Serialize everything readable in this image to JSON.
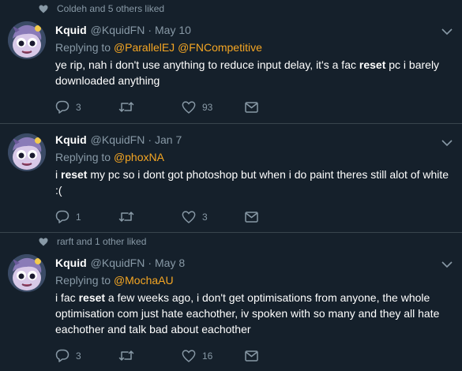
{
  "tweets": [
    {
      "liked_by": "Coldeh and 5 others liked",
      "name": "Kquid",
      "handle": "@KquidFN",
      "date": "May 10",
      "replying_to": "Replying to",
      "mentions": [
        "@ParallelEJ",
        "@FNCompetitive"
      ],
      "text_before": "ye rip, nah i don't use anything to reduce input delay, it's a fac ",
      "text_bold": "reset",
      "text_after": " pc i barely downloaded anything",
      "reply_count": "3",
      "retweet_count": "",
      "like_count": "93"
    },
    {
      "liked_by": "",
      "name": "Kquid",
      "handle": "@KquidFN",
      "date": "Jan 7",
      "replying_to": "Replying to",
      "mentions": [
        "@phoxNA"
      ],
      "text_before": "i ",
      "text_bold": "reset",
      "text_after": " my pc so i dont got photoshop but when i do paint theres still alot of white :(",
      "reply_count": "1",
      "retweet_count": "",
      "like_count": "3"
    },
    {
      "liked_by": "rarft and 1 other liked",
      "name": "Kquid",
      "handle": "@KquidFN",
      "date": "May 8",
      "replying_to": "Replying to",
      "mentions": [
        "@MochaAU"
      ],
      "text_before": "i fac ",
      "text_bold": "reset",
      "text_after": " a few weeks ago, i don't get optimisations from anyone, the whole optimisation com just hate eachother, iv spoken with so many and they all hate eachother and talk bad about eachother",
      "reply_count": "3",
      "retweet_count": "",
      "like_count": "16"
    }
  ],
  "icons": {
    "liked": "heart-icon",
    "reply": "reply-icon",
    "retweet": "retweet-icon",
    "like": "heart-icon",
    "dm": "envelope-icon",
    "menu": "chevron-down-icon"
  },
  "colors": {
    "background": "#15202b",
    "divider": "#38444d",
    "muted": "#8899a6",
    "mention": "#f5a623"
  }
}
